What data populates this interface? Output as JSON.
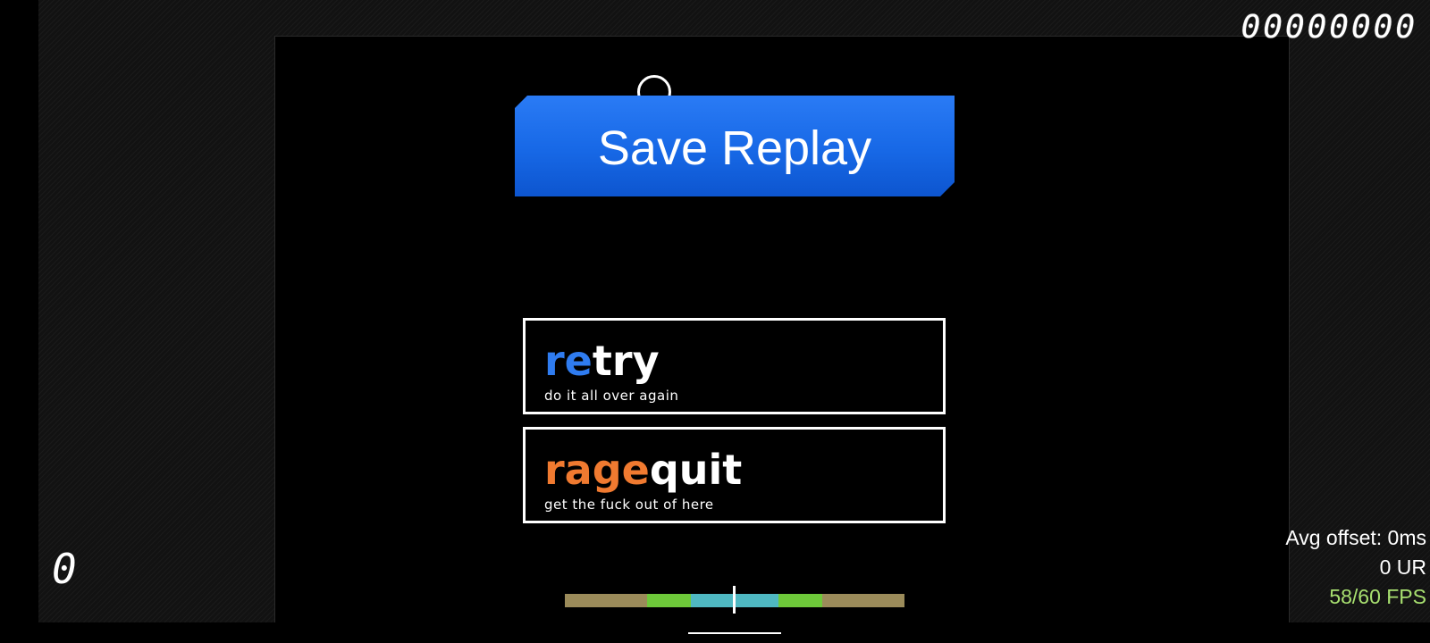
{
  "hud": {
    "score": "00000000",
    "combo": "0",
    "avg_offset": "Avg offset: 0ms",
    "unstable_rate": "0 UR",
    "fps": "58/60 FPS"
  },
  "fail_screen": {
    "save_replay_label": "Save Replay",
    "buttons": [
      {
        "highlight": "re",
        "rest": "try",
        "subtitle": "do it all over again"
      },
      {
        "highlight": "rage",
        "rest": "quit",
        "subtitle": "get the fuck out of here"
      }
    ]
  },
  "hit_error_meter": {
    "value": 0,
    "colors": {
      "meh": "#9b8b5a",
      "good": "#6ec93a",
      "great": "#4fb8c2"
    }
  },
  "colors": {
    "accent_blue": "#2f7cf0",
    "accent_orange": "#f07a30",
    "fps_green": "#a8e070"
  }
}
